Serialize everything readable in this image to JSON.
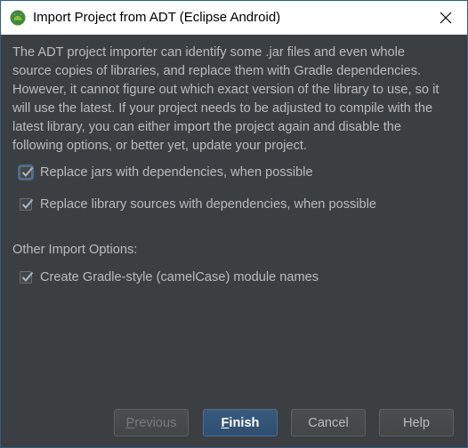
{
  "window": {
    "title": "Import Project from ADT (Eclipse Android)"
  },
  "description_lines": [
    "The ADT project importer can identify some .jar files and even whole",
    "source copies of libraries, and replace them with Gradle dependencies.",
    "However, it cannot figure out which exact version of the library to use, so it",
    "will use the latest. If your project needs to be adjusted to compile with the",
    "latest library, you can either import the project again and disable the",
    "following options, or better yet, update your project."
  ],
  "options": [
    {
      "label": "Replace jars with dependencies, when possible",
      "checked": true,
      "focused": true
    },
    {
      "label": "Replace library sources with dependencies, when possible",
      "checked": true,
      "focused": false
    }
  ],
  "other_options_label": "Other Import Options:",
  "other_options": [
    {
      "label": "Create Gradle-style (camelCase) module names",
      "checked": true
    }
  ],
  "buttons": {
    "previous": {
      "mnemonic": "P",
      "rest": "revious",
      "enabled": false
    },
    "finish": {
      "mnemonic": "F",
      "rest": "inish",
      "default": true
    },
    "cancel": {
      "label": "Cancel"
    },
    "help": {
      "label": "Help"
    }
  },
  "colors": {
    "background": "#3c3f41",
    "text": "#bbbbbb",
    "default_button": "#365880",
    "android_icon": "#a4c639"
  }
}
